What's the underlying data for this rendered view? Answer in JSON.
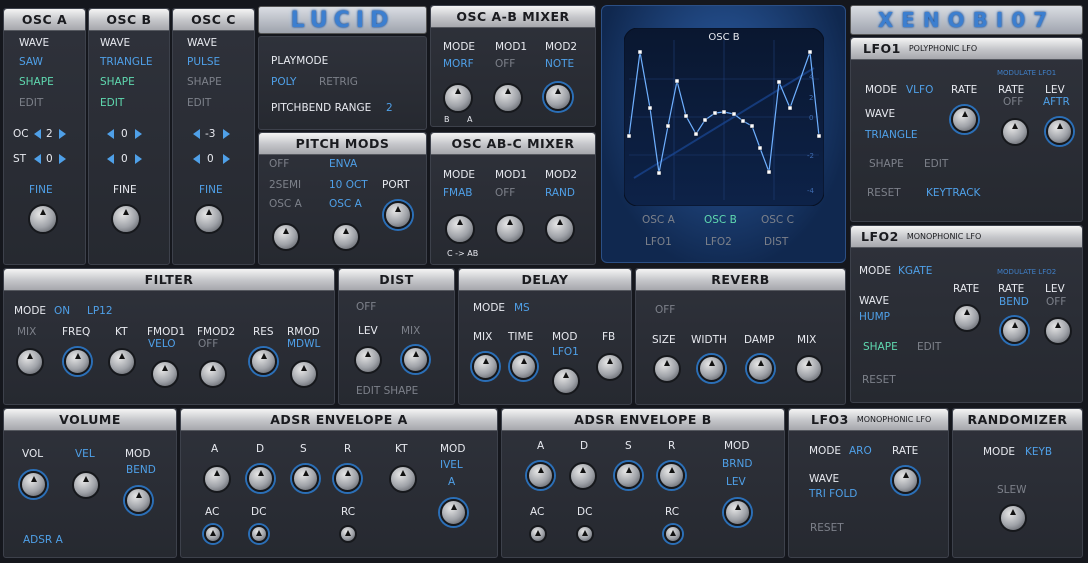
{
  "branding": {
    "lucid": "LUCID",
    "xenobi": "XENOBI07"
  },
  "osc": [
    {
      "title": "OSC A",
      "wave_label": "WAVE",
      "wave": "SAW",
      "shape": "SHAPE",
      "edit": "EDIT",
      "oc_label": "OC",
      "oc": "2",
      "st_label": "ST",
      "st": "0",
      "fine": "FINE"
    },
    {
      "title": "OSC B",
      "wave_label": "WAVE",
      "wave": "TRIANGLE",
      "shape": "SHAPE",
      "edit": "EDIT",
      "oc": "0",
      "st": "0",
      "fine": "FINE"
    },
    {
      "title": "OSC C",
      "wave_label": "WAVE",
      "wave": "PULSE",
      "shape": "SHAPE",
      "edit": "EDIT",
      "oc": "-3",
      "st": "0",
      "fine": "FINE"
    }
  ],
  "lucid_panel": {
    "playmode_label": "PLAYMODE",
    "poly": "POLY",
    "retrig": "RETRIG",
    "pitchbend_label": "PITCHBEND RANGE",
    "pitchbend": "2"
  },
  "pitch_mods": {
    "title": "PITCH MODS",
    "off": "OFF",
    "enva": "ENVA",
    "semi": "2SEMI",
    "oct": "10 OCT",
    "port": "PORT",
    "osca1": "OSC A",
    "osca2": "OSC A"
  },
  "mixer_ab": {
    "title": "OSC A-B MIXER",
    "mode_label": "MODE",
    "mode": "MORF",
    "mod1_label": "MOD1",
    "mod1": "OFF",
    "mod2_label": "MOD2",
    "mod2": "NOTE",
    "b": "B",
    "a": "A"
  },
  "mixer_abc": {
    "title": "OSC AB-C MIXER",
    "mode_label": "MODE",
    "mode": "FMAB",
    "mod1_label": "MOD1",
    "mod1": "OFF",
    "mod2_label": "MOD2",
    "mod2": "RAND",
    "ctoab": "C -> AB"
  },
  "display": {
    "title": "OSC B",
    "ticks_right": [
      "4",
      "2",
      "0",
      "-2",
      "-4"
    ],
    "sel": [
      "OSC A",
      "OSC B",
      "OSC C",
      "LFO1",
      "LFO2",
      "DIST"
    ]
  },
  "lfo1": {
    "title": "LFO1",
    "sub": "POLYPHONIC LFO",
    "mode_label": "MODE",
    "mode": "VLFO",
    "rate": "RATE",
    "wave_label": "WAVE",
    "wave": "TRIANGLE",
    "shape": "SHAPE",
    "edit": "EDIT",
    "reset": "RESET",
    "keytrack": "KEYTRACK",
    "modulate": "MODULATE LFO1",
    "mrate": "RATE",
    "mrate_val": "OFF",
    "mlev": "LEV",
    "mlev_val": "AFTR"
  },
  "lfo2": {
    "title": "LFO2",
    "sub": "MONOPHONIC LFO",
    "mode_label": "MODE",
    "mode": "KGATE",
    "rate": "RATE",
    "wave_label": "WAVE",
    "wave": "HUMP",
    "shape": "SHAPE",
    "edit": "EDIT",
    "reset": "RESET",
    "modulate": "MODULATE LFO2",
    "mrate": "RATE",
    "mrate_val": "BEND",
    "mlev": "LEV",
    "mlev_val": "OFF"
  },
  "filter": {
    "title": "FILTER",
    "mode_label": "MODE",
    "mode_on": "ON",
    "mode": "LP12",
    "mix": "MIX",
    "freq": "FREQ",
    "kt": "KT",
    "fmod1": "FMOD1",
    "fmod1_val": "VELO",
    "fmod2": "FMOD2",
    "fmod2_val": "OFF",
    "res": "RES",
    "rmod": "RMOD",
    "rmod_val": "MDWL"
  },
  "dist": {
    "title": "DIST",
    "off": "OFF",
    "lev": "LEV",
    "mix": "MIX",
    "edit_shape": "EDIT SHAPE"
  },
  "delay": {
    "title": "DELAY",
    "mode_label": "MODE",
    "mode": "MS",
    "mix": "MIX",
    "time": "TIME",
    "mod": "MOD",
    "mod_val": "LFO1",
    "fb": "FB"
  },
  "reverb": {
    "title": "REVERB",
    "off": "OFF",
    "size": "SIZE",
    "width": "WIDTH",
    "damp": "DAMP",
    "mix": "MIX"
  },
  "volume": {
    "title": "VOLUME",
    "vol": "VOL",
    "vel": "VEL",
    "mod": "MOD",
    "mod_val": "BEND",
    "adsr": "ADSR A"
  },
  "adsr_a": {
    "title": "ADSR ENVELOPE A",
    "a": "A",
    "d": "D",
    "s": "S",
    "r": "R",
    "kt": "KT",
    "mod": "MOD",
    "mod_val1": "IVEL",
    "mod_val2": "A",
    "ac": "AC",
    "dc": "DC",
    "rc": "RC"
  },
  "adsr_b": {
    "title": "ADSR ENVELOPE B",
    "a": "A",
    "d": "D",
    "s": "S",
    "r": "R",
    "mod": "MOD",
    "mod_val1": "BRND",
    "mod_val2": "LEV",
    "ac": "AC",
    "dc": "DC",
    "rc": "RC"
  },
  "lfo3": {
    "title": "LFO3",
    "sub": "MONOPHONIC LFO",
    "mode_label": "MODE",
    "mode": "ARO",
    "rate": "RATE",
    "wave_label": "WAVE",
    "wave": "TRI FOLD",
    "reset": "RESET"
  },
  "randomizer": {
    "title": "RANDOMIZER",
    "mode_label": "MODE",
    "mode": "KEYB",
    "slew": "SLEW"
  }
}
